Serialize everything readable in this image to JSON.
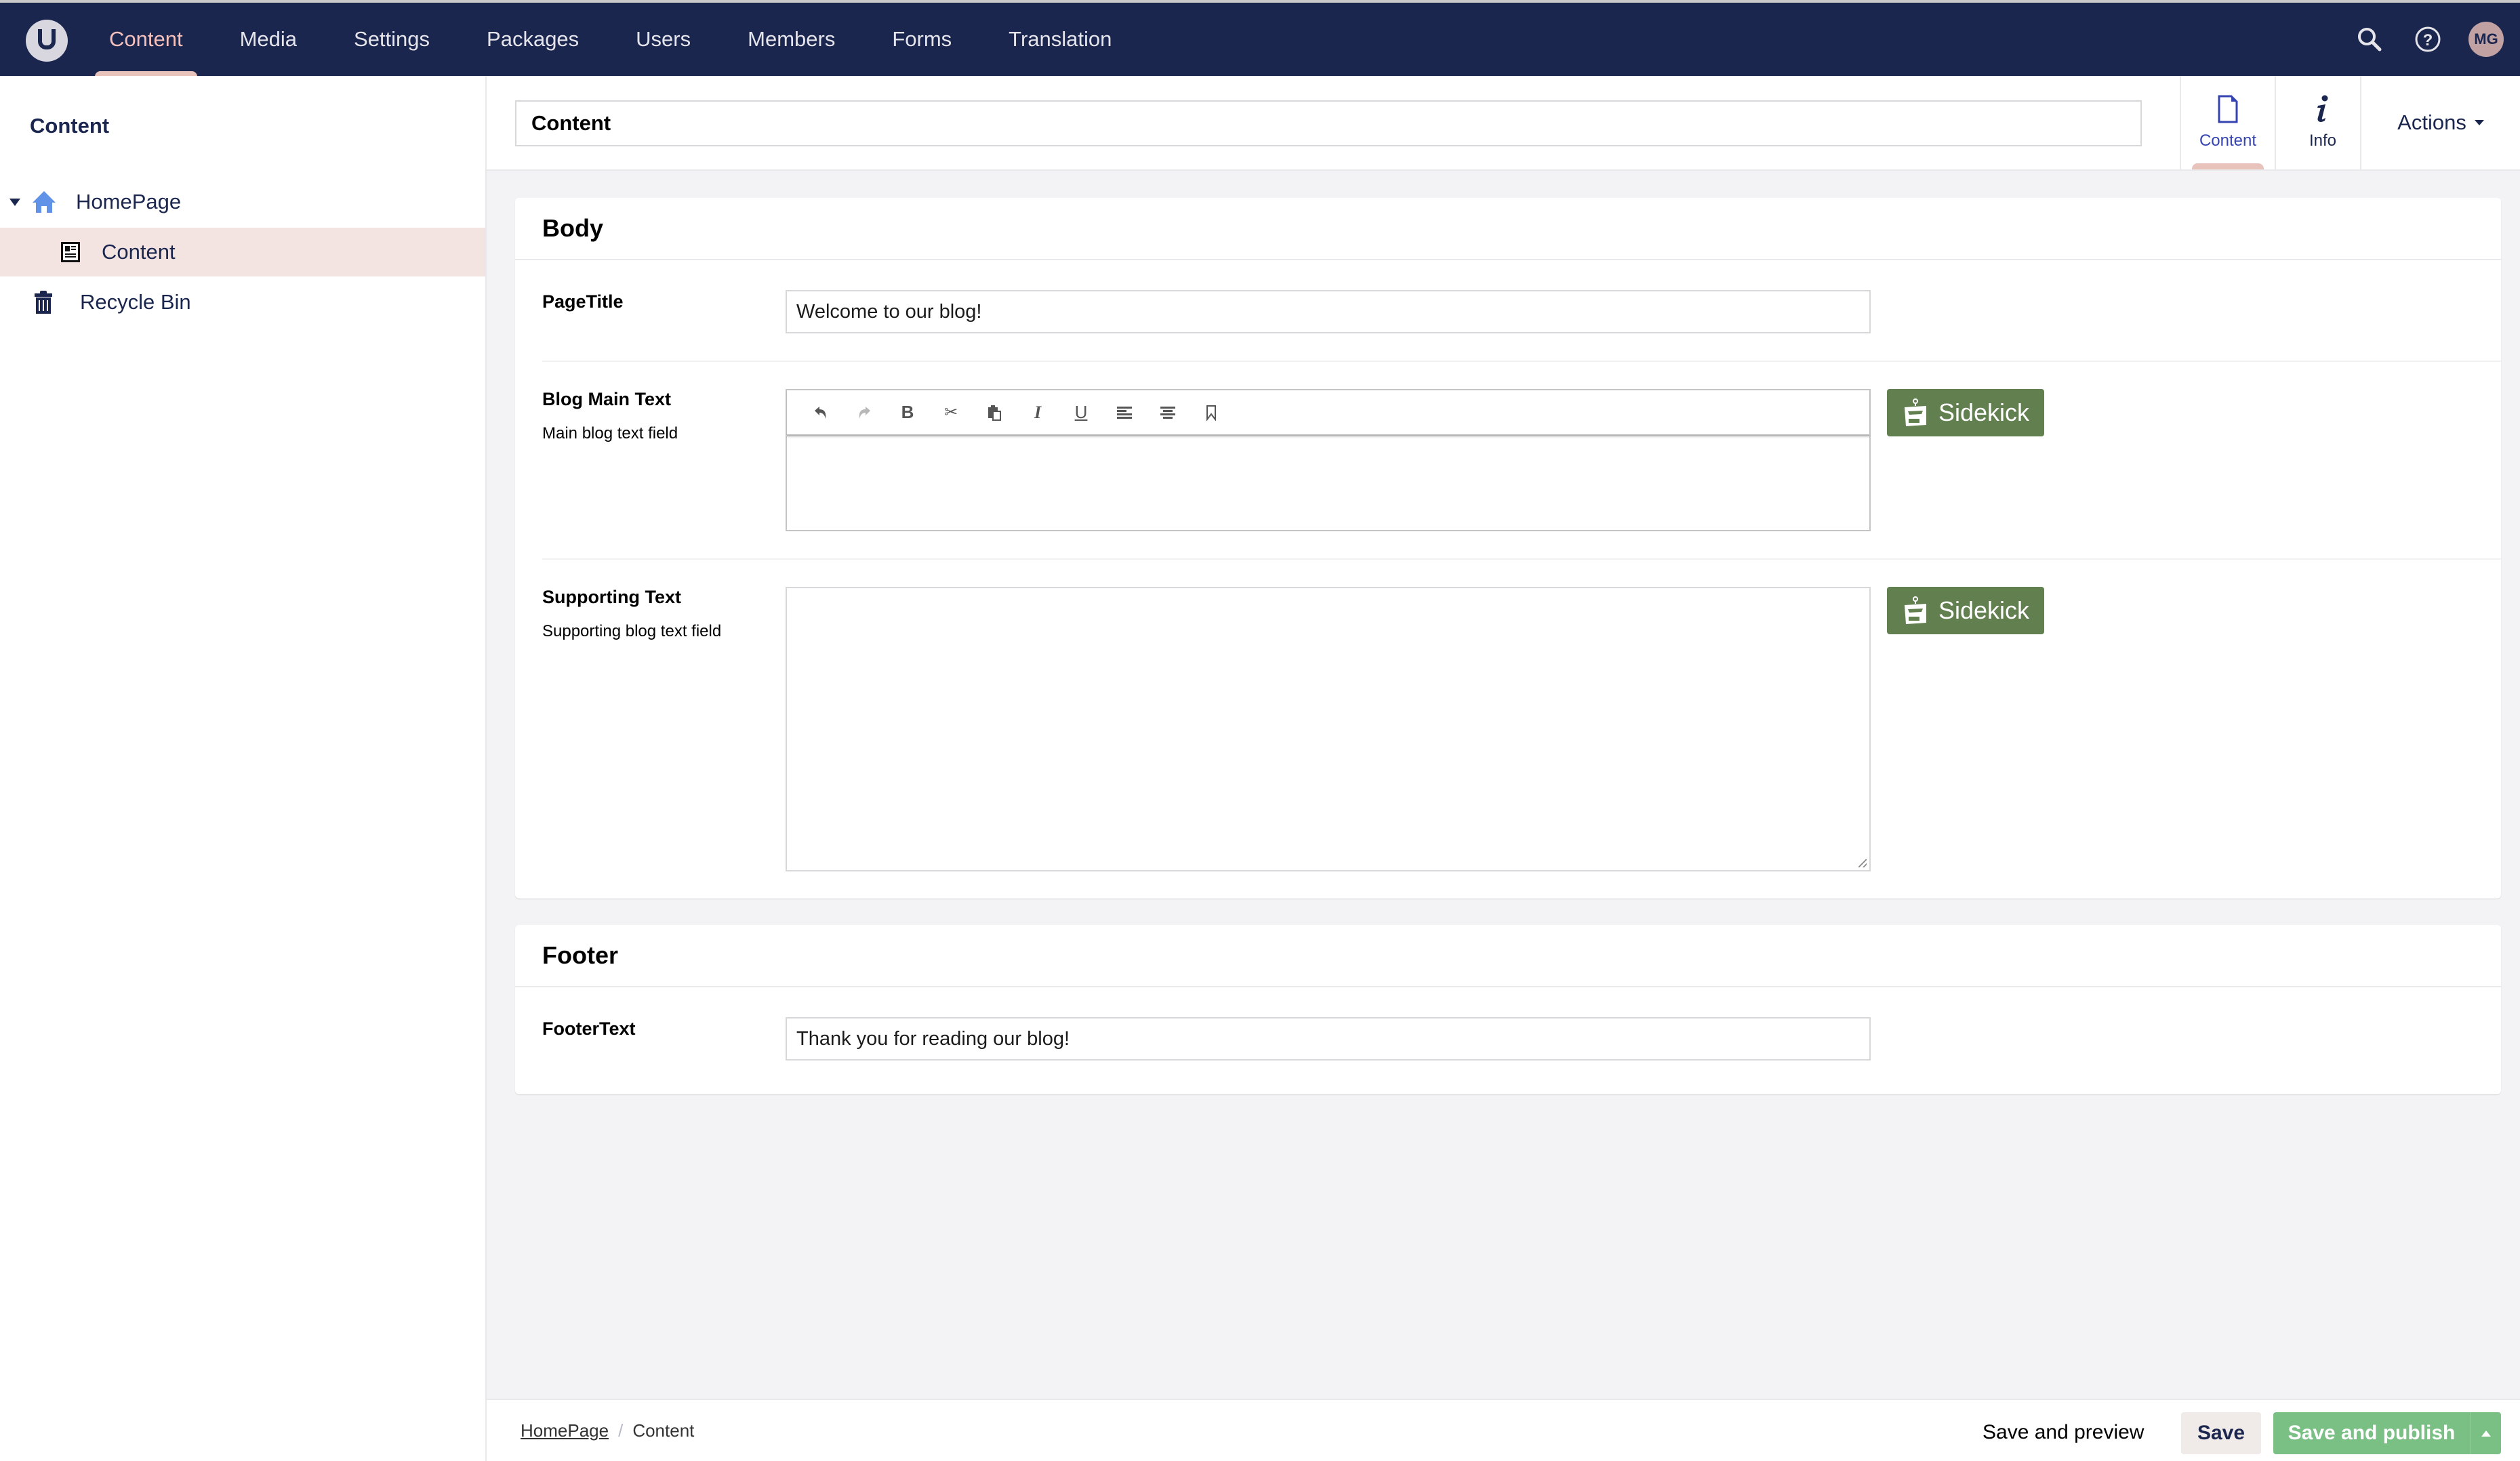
{
  "topnav": {
    "items": [
      {
        "label": "Content",
        "active": true
      },
      {
        "label": "Media",
        "active": false
      },
      {
        "label": "Settings",
        "active": false
      },
      {
        "label": "Packages",
        "active": false
      },
      {
        "label": "Users",
        "active": false
      },
      {
        "label": "Members",
        "active": false
      },
      {
        "label": "Forms",
        "active": false
      },
      {
        "label": "Translation",
        "active": false
      }
    ],
    "user_initials": "MG",
    "icons": {
      "search": "search-icon",
      "help": "help-icon"
    }
  },
  "sidebar": {
    "title": "Content",
    "tree": [
      {
        "label": "HomePage",
        "icon": "home-icon",
        "expanded": true
      },
      {
        "label": "Content",
        "icon": "document-icon",
        "selected": true
      },
      {
        "label": "Recycle Bin",
        "icon": "trash-icon"
      }
    ]
  },
  "editor": {
    "name_value": "Content",
    "apps": [
      {
        "label": "Content",
        "icon": "document-icon",
        "active": true
      },
      {
        "label": "Info",
        "icon": "info-icon",
        "active": false
      }
    ],
    "actions_label": "Actions"
  },
  "groups": {
    "body": {
      "title": "Body",
      "page_title": {
        "label": "PageTitle",
        "value": "Welcome to our blog!"
      },
      "blog_main_text": {
        "label": "Blog Main Text",
        "description": "Main blog text field",
        "value": "",
        "toolbar": [
          "undo",
          "redo",
          "bold",
          "cut",
          "paste",
          "italic",
          "underline",
          "align-left",
          "align-center",
          "bookmark"
        ]
      },
      "supporting_text": {
        "label": "Supporting Text",
        "description": "Supporting blog text field",
        "value": ""
      }
    },
    "footer": {
      "title": "Footer",
      "footer_text": {
        "label": "FooterText",
        "value": "Thank you for reading our blog!"
      }
    }
  },
  "sidekick_label": "Sidekick",
  "colors": {
    "nav_bg": "#1b264f",
    "accent_pink": "#e8c3bc",
    "sidekick_green": "#62804f",
    "publish_green": "#7abf84",
    "selected_row": "#f3e4e2"
  },
  "bottombar": {
    "breadcrumb": [
      "HomePage",
      "Content"
    ],
    "save_preview_label": "Save and preview",
    "save_label": "Save",
    "publish_label": "Save and publish"
  }
}
